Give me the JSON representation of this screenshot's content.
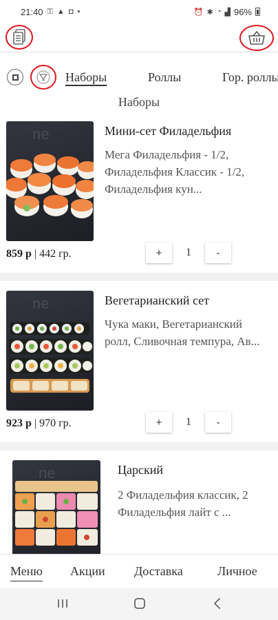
{
  "status_bar": {
    "time": "21:40",
    "battery": "96%"
  },
  "app_bar": {
    "left_icon": "document-menu-icon",
    "right_icon": "basket-icon",
    "highlight_color": "#e0141c"
  },
  "categories": {
    "tabs": [
      {
        "label": "Наборы",
        "active": true
      },
      {
        "label": "Роллы",
        "active": false
      },
      {
        "label": "Гор. роллы",
        "active": false
      }
    ]
  },
  "section_title": "Наборы",
  "products": [
    {
      "title": "Мини-сет Филадельфия",
      "description": "Мега Филадельфия - 1/2, Филадельфия Классик - 1/2, Филадельфия кун...",
      "price": "859 р",
      "weight": "442 гр.",
      "quantity": "1",
      "plus": "+",
      "minus": "-"
    },
    {
      "title": "Вегетарианский сет",
      "description": "Чука маки, Вегетарианский ролл, Сливочная темпура, Ав...",
      "price": "923 р",
      "weight": "970 гр.",
      "quantity": "1",
      "plus": "+",
      "minus": "-"
    },
    {
      "title": "Царский",
      "description": "2 Филадельфия классик, 2 Филадельфия лайт с ..."
    }
  ],
  "bottom_nav": [
    {
      "label": "Меню",
      "active": true
    },
    {
      "label": "Акции",
      "active": false
    },
    {
      "label": "Доставка",
      "active": false
    },
    {
      "label": "Личное",
      "active": false
    }
  ],
  "watermark": "ne"
}
